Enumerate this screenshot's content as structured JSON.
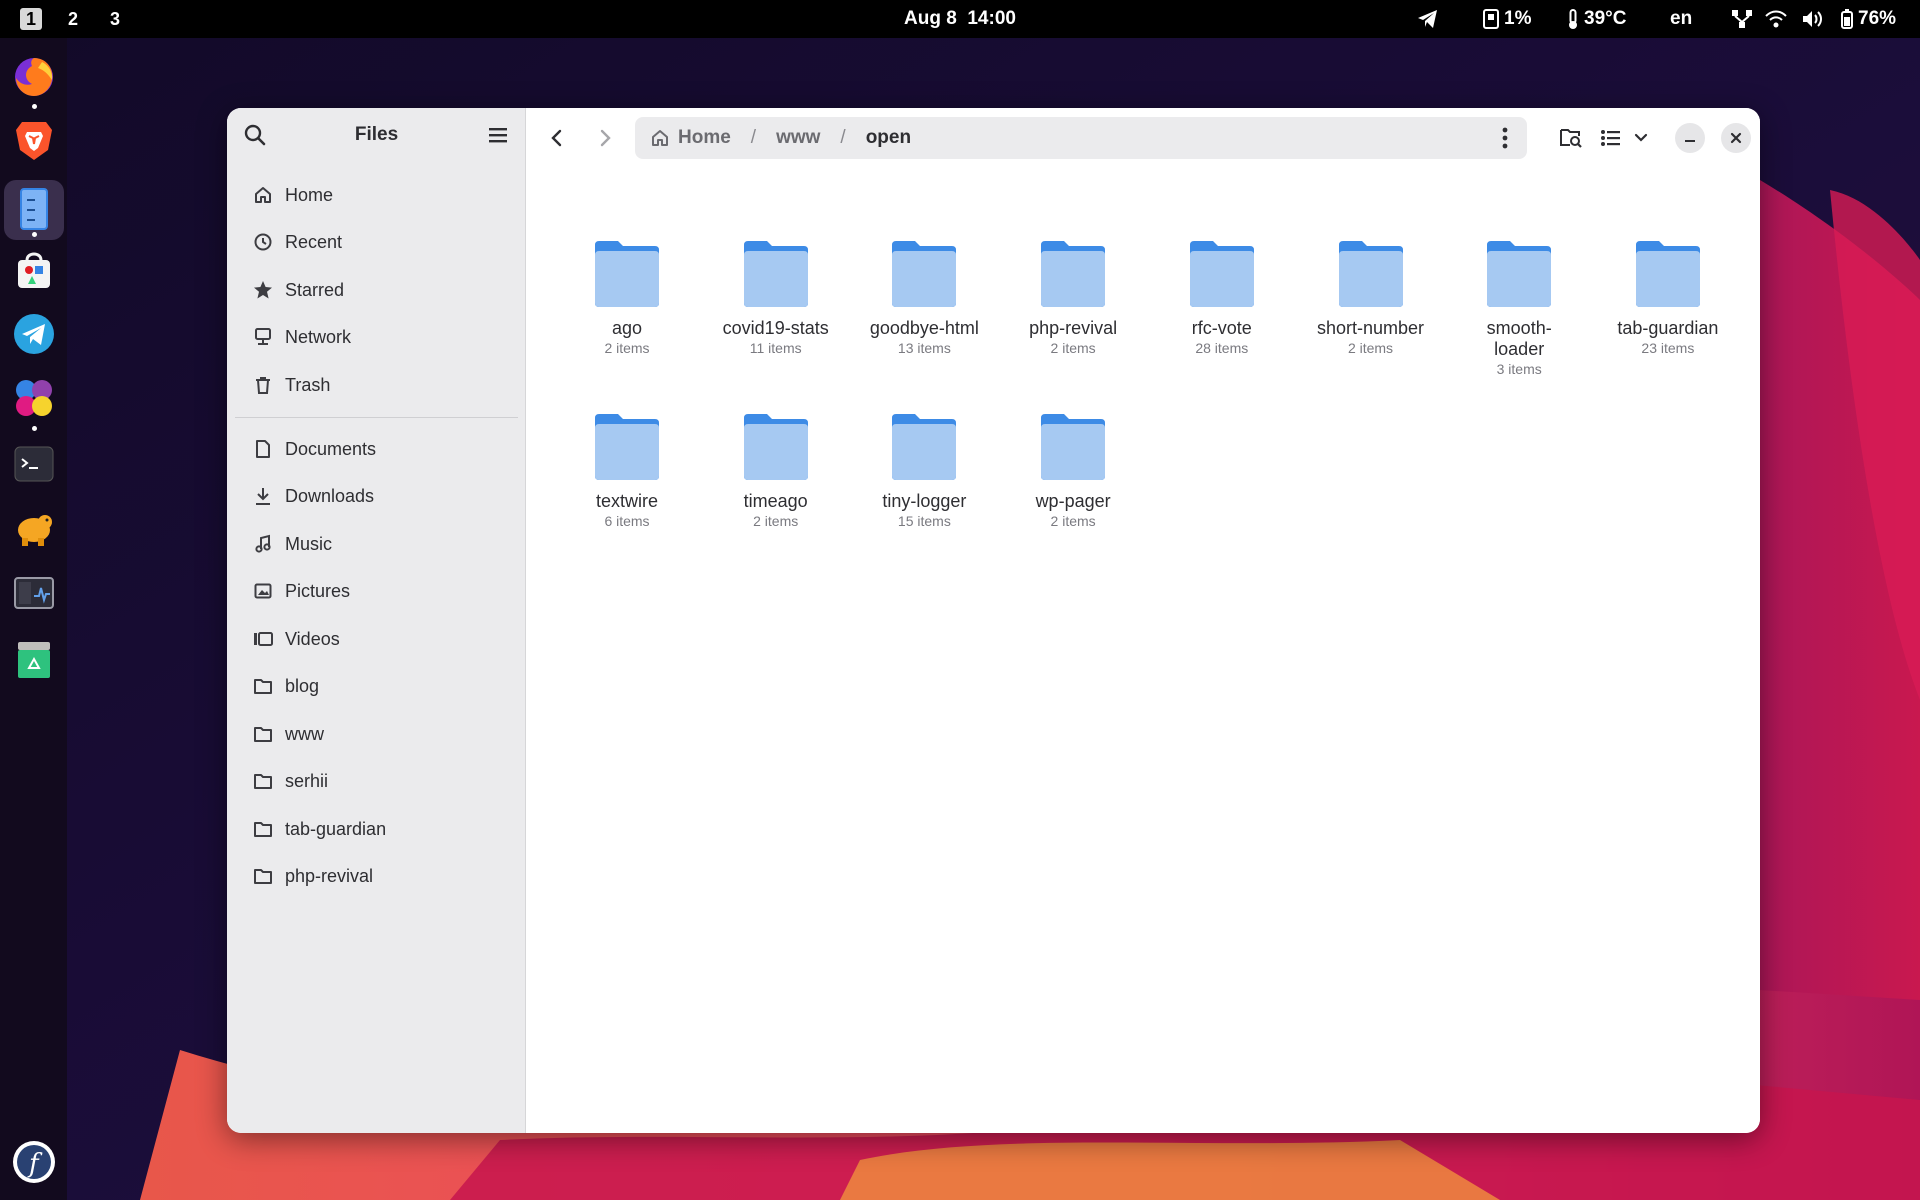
{
  "topbar": {
    "workspaces": [
      "1",
      "2",
      "3"
    ],
    "active_workspace": "1",
    "date": "Aug 8",
    "time": "14:00",
    "cpu": "1%",
    "temperature": "39°C",
    "language": "en",
    "battery": "76%"
  },
  "dock": {
    "apps": [
      "firefox-icon",
      "brave-icon",
      "files-icon",
      "software-icon",
      "telegram-icon",
      "slack-icon",
      "terminal-icon",
      "dbeaver-icon",
      "system-monitor-icon",
      "trash-app-icon"
    ],
    "running": [
      0,
      2
    ],
    "fedora": "f"
  },
  "sidebar": {
    "title": "Files",
    "places": [
      {
        "label": "Home",
        "icon": "home-icon"
      },
      {
        "label": "Recent",
        "icon": "clock-icon"
      },
      {
        "label": "Starred",
        "icon": "star-icon"
      },
      {
        "label": "Network",
        "icon": "network-icon"
      },
      {
        "label": "Trash",
        "icon": "trash-icon"
      }
    ],
    "bookmarks": [
      {
        "label": "Documents",
        "icon": "document-icon"
      },
      {
        "label": "Downloads",
        "icon": "download-icon"
      },
      {
        "label": "Music",
        "icon": "music-icon"
      },
      {
        "label": "Pictures",
        "icon": "picture-icon"
      },
      {
        "label": "Videos",
        "icon": "video-icon"
      },
      {
        "label": "blog",
        "icon": "folder-icon"
      },
      {
        "label": "www",
        "icon": "folder-icon"
      },
      {
        "label": "serhii",
        "icon": "folder-icon"
      },
      {
        "label": "tab-guardian",
        "icon": "folder-icon"
      },
      {
        "label": "php-revival",
        "icon": "folder-icon"
      }
    ]
  },
  "pathbar": {
    "crumbs": [
      "Home",
      "www",
      "open"
    ],
    "separator": "/"
  },
  "folders": [
    {
      "name": "ago",
      "count": "2 items"
    },
    {
      "name": "covid19-stats",
      "count": "11 items"
    },
    {
      "name": "goodbye-html",
      "count": "13 items"
    },
    {
      "name": "php-revival",
      "count": "2 items"
    },
    {
      "name": "rfc-vote",
      "count": "28 items"
    },
    {
      "name": "short-number",
      "count": "2 items"
    },
    {
      "name": "smooth-\nloader",
      "count": "3 items"
    },
    {
      "name": "tab-guardian",
      "count": "23 items"
    },
    {
      "name": "textwire",
      "count": "6 items"
    },
    {
      "name": "timeago",
      "count": "2 items"
    },
    {
      "name": "tiny-logger",
      "count": "15 items"
    },
    {
      "name": "wp-pager",
      "count": "2 items"
    }
  ],
  "colors": {
    "folder_back": "#3d8be6",
    "folder_front": "#a6c9f2",
    "accent": "#3584e4"
  }
}
